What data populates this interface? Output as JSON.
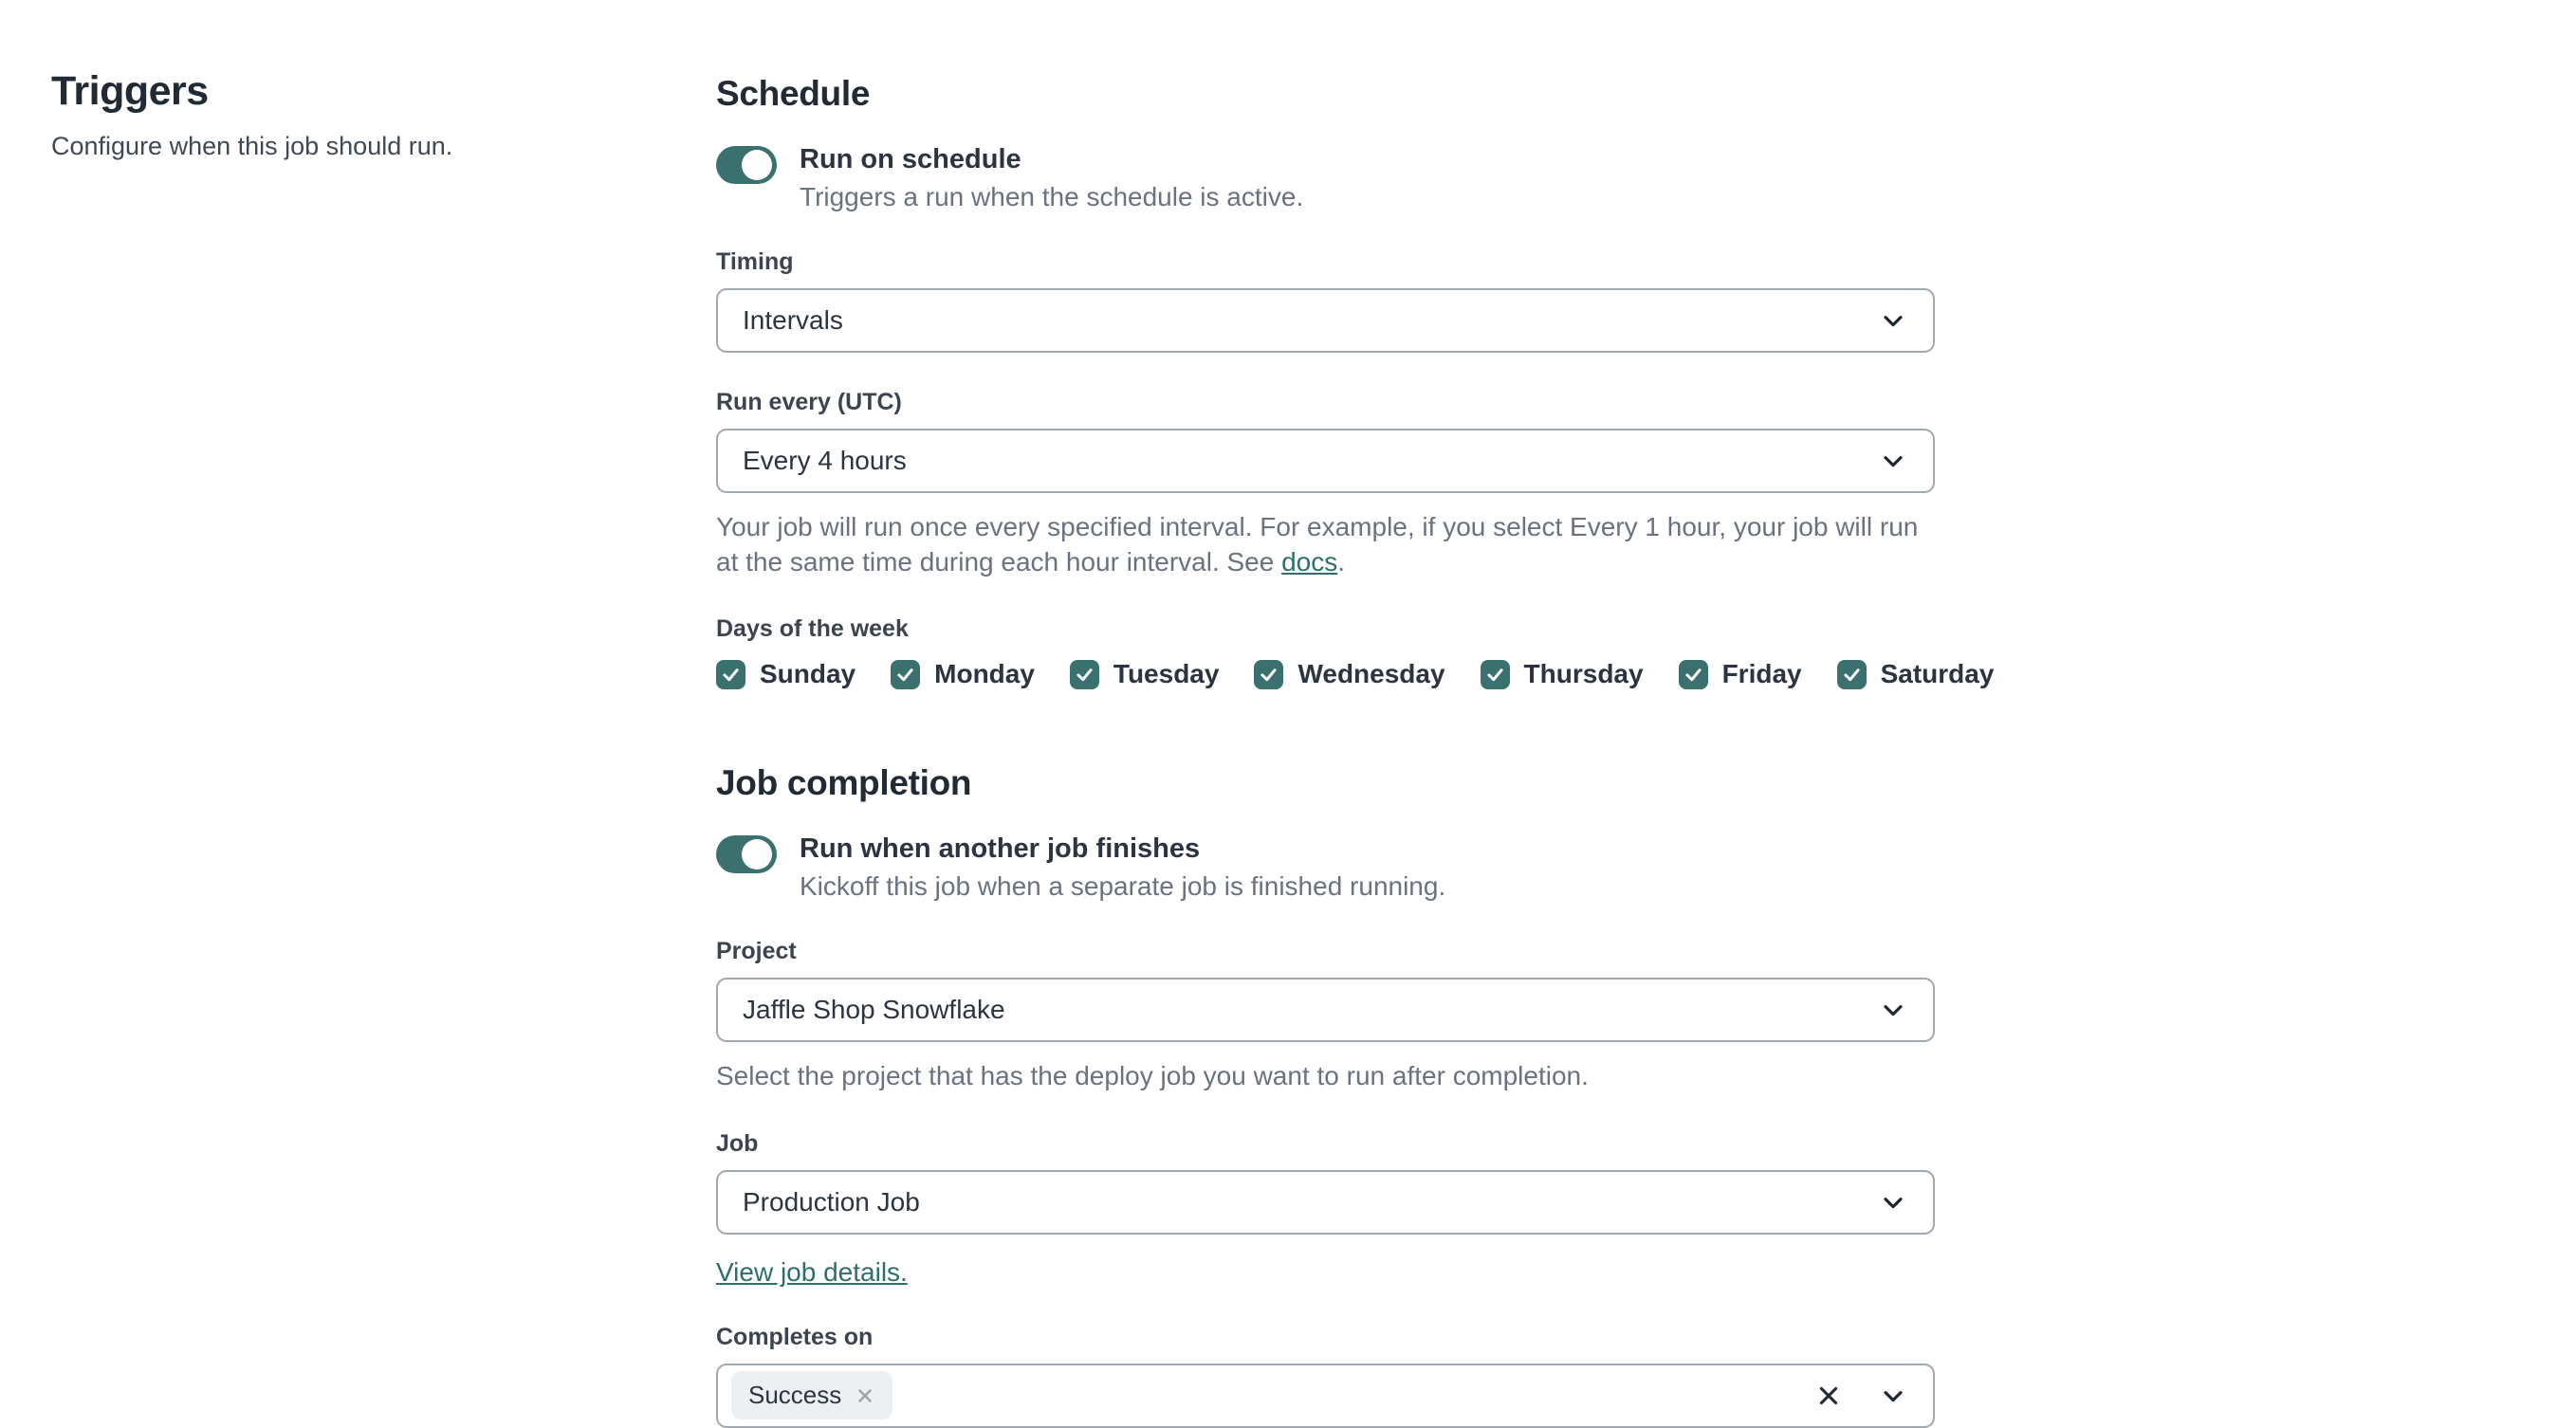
{
  "left_panel": {
    "title": "Triggers",
    "subtitle": "Configure when this job should run."
  },
  "schedule": {
    "heading": "Schedule",
    "toggle": {
      "state": "on",
      "label": "Run on schedule",
      "description": "Triggers a run when the schedule is active."
    },
    "timing": {
      "label": "Timing",
      "value": "Intervals"
    },
    "run_every": {
      "label": "Run every (UTC)",
      "value": "Every 4 hours",
      "help_prefix": "Your job will run once every specified interval. For example, if you select Every 1 hour, your job will run at the same time during each hour interval. See ",
      "help_link": "docs",
      "help_suffix": "."
    },
    "days": {
      "label": "Days of the week",
      "items": [
        {
          "label": "Sunday",
          "checked": true
        },
        {
          "label": "Monday",
          "checked": true
        },
        {
          "label": "Tuesday",
          "checked": true
        },
        {
          "label": "Wednesday",
          "checked": true
        },
        {
          "label": "Thursday",
          "checked": true
        },
        {
          "label": "Friday",
          "checked": true
        },
        {
          "label": "Saturday",
          "checked": true
        }
      ]
    }
  },
  "job_completion": {
    "heading": "Job completion",
    "toggle": {
      "state": "on",
      "label": "Run when another job finishes",
      "description": "Kickoff this job when a separate job is finished running."
    },
    "project": {
      "label": "Project",
      "value": "Jaffle Shop Snowflake",
      "help": "Select the project that has the deploy job you want to run after completion."
    },
    "job": {
      "label": "Job",
      "value": "Production Job",
      "link": "View job details."
    },
    "completes_on": {
      "label": "Completes on",
      "tags": [
        {
          "label": "Success"
        }
      ]
    }
  },
  "colors": {
    "accent_teal": "#3a706e",
    "link_teal": "#2d6f6c",
    "heading_text": "#212b36",
    "body_text": "#2b3440",
    "muted_text": "#6a7280",
    "field_border": "#a2a8b0",
    "chip_background": "#edf0f3"
  }
}
